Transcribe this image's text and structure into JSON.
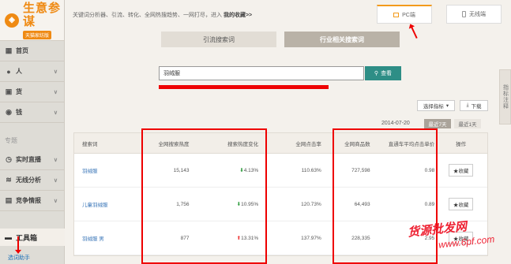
{
  "app": {
    "title": "生意参谋",
    "subtitle": "天猫家纺版"
  },
  "sidebar": {
    "items": [
      {
        "label": "首页",
        "icon": "home-icon"
      },
      {
        "label": "人",
        "icon": "person-icon"
      },
      {
        "label": "货",
        "icon": "box-icon"
      },
      {
        "label": "钱",
        "icon": "money-icon"
      }
    ],
    "section": "专题",
    "topic_items": [
      {
        "label": "实时直播",
        "icon": "clock-icon"
      },
      {
        "label": "无线分析",
        "icon": "wifi-icon"
      },
      {
        "label": "竞争情报",
        "icon": "compete-icon"
      }
    ],
    "toolbox": "工具箱",
    "sub_link": "选词助手"
  },
  "breadcrumb": {
    "text": "关键词分析器、引流、转化、全网热搜趋势、一网打尽，进入",
    "fav": "我的收藏>>"
  },
  "device_tabs": {
    "pc": "PC端",
    "mobile": "无线端"
  },
  "tabs": {
    "t1": "引流搜索词",
    "t2": "行业相关搜索词"
  },
  "search": {
    "value": "羽绒服",
    "button": "查看"
  },
  "actions": {
    "select": "选择指标",
    "download": "下载"
  },
  "date": {
    "value": "2014-07-20",
    "last7": "最近7天",
    "last1": "最近1天"
  },
  "table": {
    "headers": {
      "kw": "搜索词",
      "hot": "全网搜索热度",
      "chg": "搜索热度变化",
      "click": "全网点击率",
      "goods": "全网商品数",
      "cpc": "直通车平均点击单价",
      "op": "操作"
    },
    "rows": [
      {
        "kw": "羽绒服",
        "hot": "15,143",
        "chg": "4.13%",
        "chg_dir": "down",
        "click": "110.63%",
        "goods": "727,598",
        "cpc": "0.98",
        "op": "收藏"
      },
      {
        "kw": "儿童羽绒服",
        "hot": "1,756",
        "chg": "10.95%",
        "chg_dir": "down",
        "click": "120.73%",
        "goods": "64,493",
        "cpc": "0.89",
        "op": "收藏"
      },
      {
        "kw": "羽绒服 男",
        "hot": "877",
        "chg": "13.31%",
        "chg_dir": "up",
        "click": "137.97%",
        "goods": "228,335",
        "cpc": "2.95",
        "op": "收藏"
      }
    ]
  },
  "right_tab": "指标注释",
  "watermark": {
    "text": "货源批发网",
    "url": "www.6pf.com"
  }
}
